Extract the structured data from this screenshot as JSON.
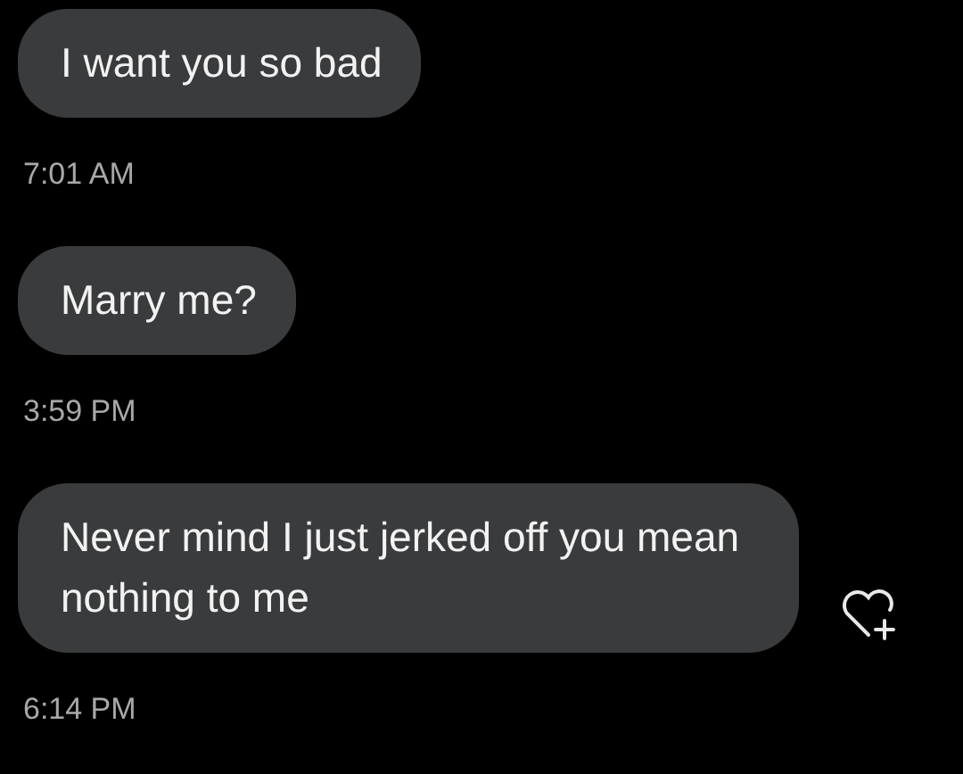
{
  "messages": [
    {
      "text": "I want you so bad",
      "time": "7:01 AM",
      "reaction_button": false
    },
    {
      "text": "Marry me?",
      "time": "3:59 PM",
      "reaction_button": false
    },
    {
      "text": "Never mind I just jerked off you mean nothing to me",
      "time": "6:14 PM",
      "reaction_button": true
    }
  ]
}
